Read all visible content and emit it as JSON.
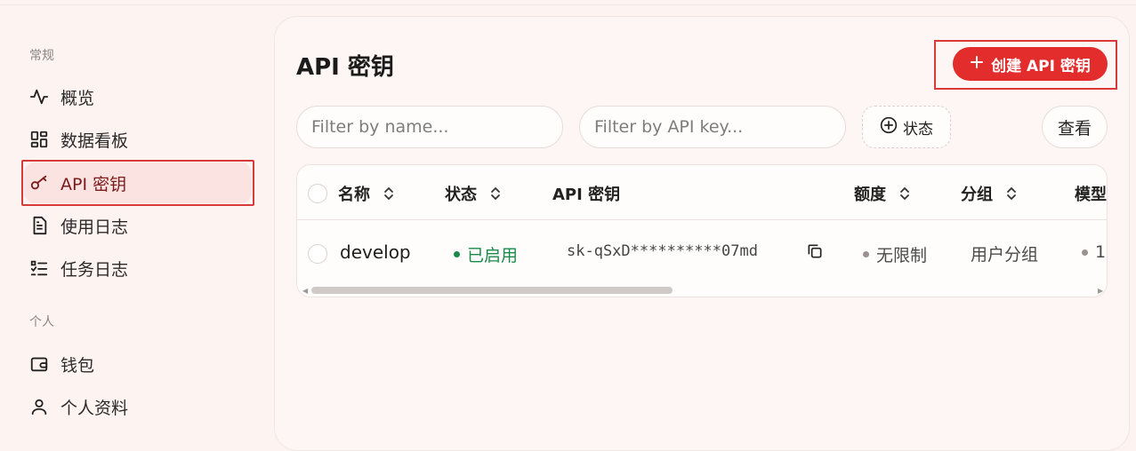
{
  "sidebar": {
    "section_general": "常规",
    "section_personal": "个人",
    "items": [
      {
        "label": "概览",
        "icon": "activity-icon"
      },
      {
        "label": "数据看板",
        "icon": "dashboard-icon"
      },
      {
        "label": "API 密钥",
        "icon": "key-icon",
        "active": true
      },
      {
        "label": "使用日志",
        "icon": "file-text-icon"
      },
      {
        "label": "任务日志",
        "icon": "list-check-icon"
      },
      {
        "label": "钱包",
        "icon": "wallet-icon"
      },
      {
        "label": "个人资料",
        "icon": "user-icon"
      }
    ]
  },
  "main": {
    "title": "API 密钥",
    "create_button": "创建 API 密钥",
    "filter_name_placeholder": "Filter by name...",
    "filter_key_placeholder": "Filter by API key...",
    "status_filter": "状态",
    "view_button": "查看"
  },
  "table": {
    "columns": [
      "名称",
      "状态",
      "API 密钥",
      "额度",
      "分组",
      "模型"
    ],
    "rows": [
      {
        "name": "develop",
        "status": "已启用",
        "key": "sk-qSxD**********07md",
        "quota": "无限制",
        "group": "用户分组",
        "models": "1"
      }
    ]
  },
  "colors": {
    "accent": "#e32c2c",
    "status_active": "#1a8a4a",
    "muted_dot": "#9a9190"
  }
}
